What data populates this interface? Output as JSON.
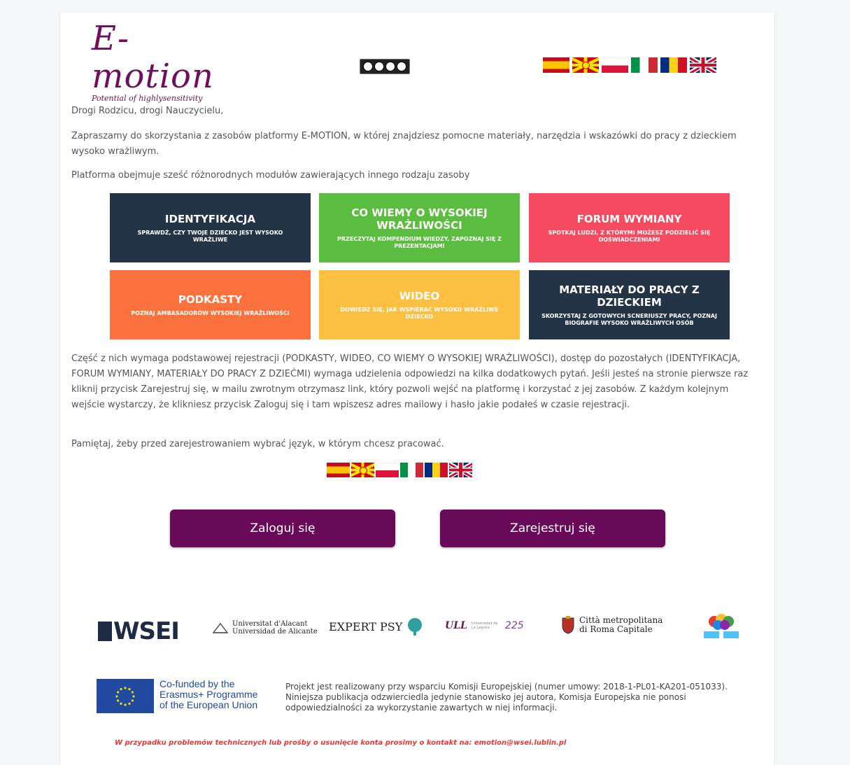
{
  "header": {
    "logo_title": "E-motion",
    "logo_subtitle": "Potential of highlysensitivity",
    "license_badge": "CC BY NC ND",
    "languages": [
      {
        "code": "es",
        "icon": "spain-flag-icon"
      },
      {
        "code": "mk",
        "icon": "macedonia-flag-icon"
      },
      {
        "code": "pl",
        "icon": "poland-flag-icon"
      },
      {
        "code": "it",
        "icon": "italy-flag-icon"
      },
      {
        "code": "ro",
        "icon": "romania-flag-icon"
      },
      {
        "code": "en",
        "icon": "uk-flag-icon"
      }
    ]
  },
  "intro": {
    "greeting": "Drogi Rodzicu, drogi Nauczycielu,",
    "invitation": "Zapraszamy do skorzystania z zasobów platformy E-MOTION, w której znajdziesz pomocne materiały, narzędzia i wskazówki do pracy z dzieckiem wysoko wrażliwym.",
    "modules_intro": "Platforma obejmuje sześć różnorodnych modułów zawierających innego rodzaju zasoby"
  },
  "modules": [
    {
      "title": "IDENTYFIKACJA",
      "subtitle": "SPRAWDŹ, CZY TWOJE DZIECKO JEST WYSOKO WRAŻLIWE",
      "color": "#243447"
    },
    {
      "title": "CO WIEMY O WYSOKIEJ WRAŻLIWOŚCI",
      "subtitle": "PRZECZYTAJ KOMPENDIUM WIEDZY, ZAPOZNAJ SIĘ Z PREZENTACJAMI",
      "color": "#5bbd3f"
    },
    {
      "title": "FORUM WYMIANY",
      "subtitle": "SPOTKAJ LUDZI, Z KTÓRYMI MOŻESZ PODZIELIĆ SIĘ DOŚWIADCZENIAMI",
      "color": "#f54a5f"
    },
    {
      "title": "PODKASTY",
      "subtitle": "POZNAJ AMBASADORÓW WYSOKIEJ WRAŻLIWOŚCI",
      "color": "#fb723f"
    },
    {
      "title": "WIDEO",
      "subtitle": "DOWIEDZ SIĘ, JAK WSPIERAĆ WYSOKO WRAŻLIWE DZIECKO",
      "color": "#fcbf3f"
    },
    {
      "title": "MATERIAŁY DO PRACY Z DZIECKIEM",
      "subtitle": "SKORZYSTAJ Z GOTOWYCH SCNERIUSZY PRACY, POZNAJ BIOGRAFIE WYSOKO WRAŻLIWYCH OSÓB",
      "color": "#243447"
    }
  ],
  "info": {
    "registration": "Część z nich wymaga podstawowej rejestracji (PODKASTY, WIDEO, CO WIEMY O WYSOKIEJ WRAŻLIWOŚCI), dostęp do pozostałych (IDENTYFIKACJA, FORUM WYMIANY, MATERIAŁY DO PRACY Z DZIEĆMI) wymaga udzielenia odpowiedzi na kilka dodatkowych pytań. Jeśli jesteś na stronie pierwsze raz kliknij przycisk Zarejestruj się, w mailu zwrotnym otrzymasz link, który pozwoli wejść na platformę i korzystać z jej zasobów. Z każdym kolejnym wejście wystarczy, że klikniesz przycisk Zaloguj się i tam wpiszesz adres mailowy i hasło jakie podałeś w czasie rejestracji.",
    "language_hint": "Pamiętaj, żeby przed zarejestrowaniem wybrać język, w którym chcesz pracować."
  },
  "actions": {
    "login_label": "Zaloguj się",
    "register_label": "Zarejestruj się"
  },
  "partners": {
    "wsei": "WSEI",
    "alicante_line1": "Universitat d'Alacant",
    "alicante_line2": "Universidad de Alicante",
    "expert": "EXPERT PSY",
    "ull": "ULL",
    "ull_small": "Universidad de La Laguna",
    "ull_anniversary": "225",
    "roma_line1": "Città metropolitana",
    "roma_line2": "di Roma Capitale"
  },
  "footer": {
    "eu_line1": "Co-funded by the",
    "eu_line2": "Erasmus+ Programme",
    "eu_line3": "of the European Union",
    "disclaimer": "Projekt jest realizowany przy wsparciu Komisji Europejskiej (numer umowy: 2018-1-PL01-KA201-051033). Niniejsza publikacja odzwierciedla jedynie stanowisko jej autora, Komisja Europejska nie ponosi odpowiedzialności za wykorzystanie zawartych w niej informacji.",
    "contact": "W przypadku problemów technicznych lub prośby o usunięcie konta prosimy o kontakt na: emotion@wsei.lublin.pl"
  }
}
